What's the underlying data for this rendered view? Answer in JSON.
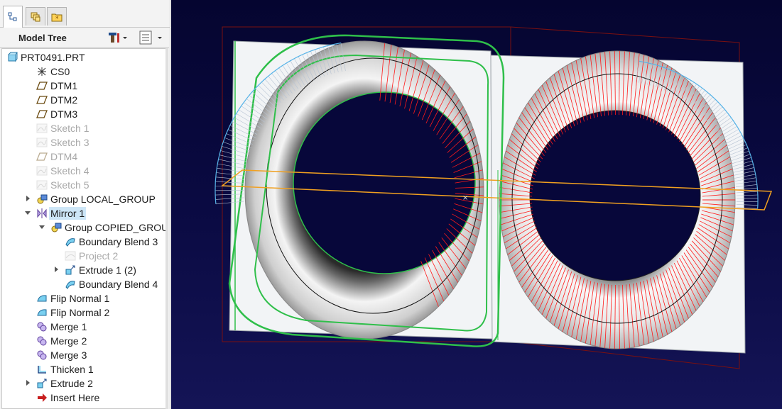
{
  "tabs": [
    {
      "name": "model-tree-tab",
      "icon": "tree-icon",
      "active": true
    },
    {
      "name": "layers-tab",
      "icon": "layers-icon",
      "active": false
    },
    {
      "name": "favorites-tab",
      "icon": "folder-star-icon",
      "active": false
    }
  ],
  "panel": {
    "title": "Model Tree",
    "settings_icon": "tools-icon",
    "show_icon": "show-list-icon"
  },
  "tree": [
    {
      "label": "PRT0491.PRT",
      "icon": "part-icon",
      "indent": 0,
      "expander": "",
      "dim": false,
      "selected": false
    },
    {
      "label": "CS0",
      "icon": "csys-icon",
      "indent": 1,
      "expander": "",
      "dim": false,
      "selected": false
    },
    {
      "label": "DTM1",
      "icon": "datum-plane-icon",
      "indent": 1,
      "expander": "",
      "dim": false,
      "selected": false
    },
    {
      "label": "DTM2",
      "icon": "datum-plane-icon",
      "indent": 1,
      "expander": "",
      "dim": false,
      "selected": false
    },
    {
      "label": "DTM3",
      "icon": "datum-plane-icon",
      "indent": 1,
      "expander": "",
      "dim": false,
      "selected": false
    },
    {
      "label": "Sketch 1",
      "icon": "sketch-icon",
      "indent": 1,
      "expander": "",
      "dim": true,
      "selected": false
    },
    {
      "label": "Sketch 3",
      "icon": "sketch-icon",
      "indent": 1,
      "expander": "",
      "dim": true,
      "selected": false
    },
    {
      "label": "DTM4",
      "icon": "datum-plane-icon",
      "indent": 1,
      "expander": "",
      "dim": true,
      "selected": false
    },
    {
      "label": "Sketch 4",
      "icon": "sketch-icon",
      "indent": 1,
      "expander": "",
      "dim": true,
      "selected": false
    },
    {
      "label": "Sketch 5",
      "icon": "sketch-icon",
      "indent": 1,
      "expander": "",
      "dim": true,
      "selected": false
    },
    {
      "label": "Group LOCAL_GROUP",
      "icon": "group-icon",
      "indent": 1,
      "expander": "collapsed",
      "dim": false,
      "selected": false
    },
    {
      "label": "Mirror 1",
      "icon": "mirror-icon",
      "indent": 1,
      "expander": "expanded",
      "dim": false,
      "selected": true
    },
    {
      "label": "Group COPIED_GROUP",
      "icon": "group-icon",
      "indent": 2,
      "expander": "expanded",
      "dim": false,
      "selected": false
    },
    {
      "label": "Boundary Blend 3",
      "icon": "boundary-blend-icon",
      "indent": 3,
      "expander": "",
      "dim": false,
      "selected": false
    },
    {
      "label": "Project 2",
      "icon": "project-icon",
      "indent": 3,
      "expander": "",
      "dim": true,
      "selected": false
    },
    {
      "label": "Extrude 1 (2)",
      "icon": "extrude-icon",
      "indent": 3,
      "expander": "collapsed",
      "dim": false,
      "selected": false
    },
    {
      "label": "Boundary Blend 4",
      "icon": "boundary-blend-icon",
      "indent": 3,
      "expander": "",
      "dim": false,
      "selected": false
    },
    {
      "label": "Flip Normal 1",
      "icon": "flip-normal-icon",
      "indent": 1,
      "expander": "",
      "dim": false,
      "selected": false
    },
    {
      "label": "Flip Normal 2",
      "icon": "flip-normal-icon",
      "indent": 1,
      "expander": "",
      "dim": false,
      "selected": false
    },
    {
      "label": "Merge 1",
      "icon": "merge-icon",
      "indent": 1,
      "expander": "",
      "dim": false,
      "selected": false
    },
    {
      "label": "Merge 2",
      "icon": "merge-icon",
      "indent": 1,
      "expander": "",
      "dim": false,
      "selected": false
    },
    {
      "label": "Merge 3",
      "icon": "merge-icon",
      "indent": 1,
      "expander": "",
      "dim": false,
      "selected": false
    },
    {
      "label": "Thicken 1",
      "icon": "thicken-icon",
      "indent": 1,
      "expander": "",
      "dim": false,
      "selected": false
    },
    {
      "label": "Extrude 2",
      "icon": "extrude-icon",
      "indent": 1,
      "expander": "collapsed",
      "dim": false,
      "selected": false
    },
    {
      "label": "Insert Here",
      "icon": "insert-here-icon",
      "indent": 1,
      "expander": "",
      "dim": false,
      "selected": false
    }
  ],
  "viewport": {
    "name": "3d-graphics-window",
    "background": "#0a0a42",
    "surface_color": "#f2f4f6",
    "curve_red": "#ff1a1a",
    "curve_green": "#2fbf4a",
    "curve_blue": "#56b3e8",
    "plane_orange": "#f0a020",
    "frame_dark_red": "#7a1010"
  }
}
